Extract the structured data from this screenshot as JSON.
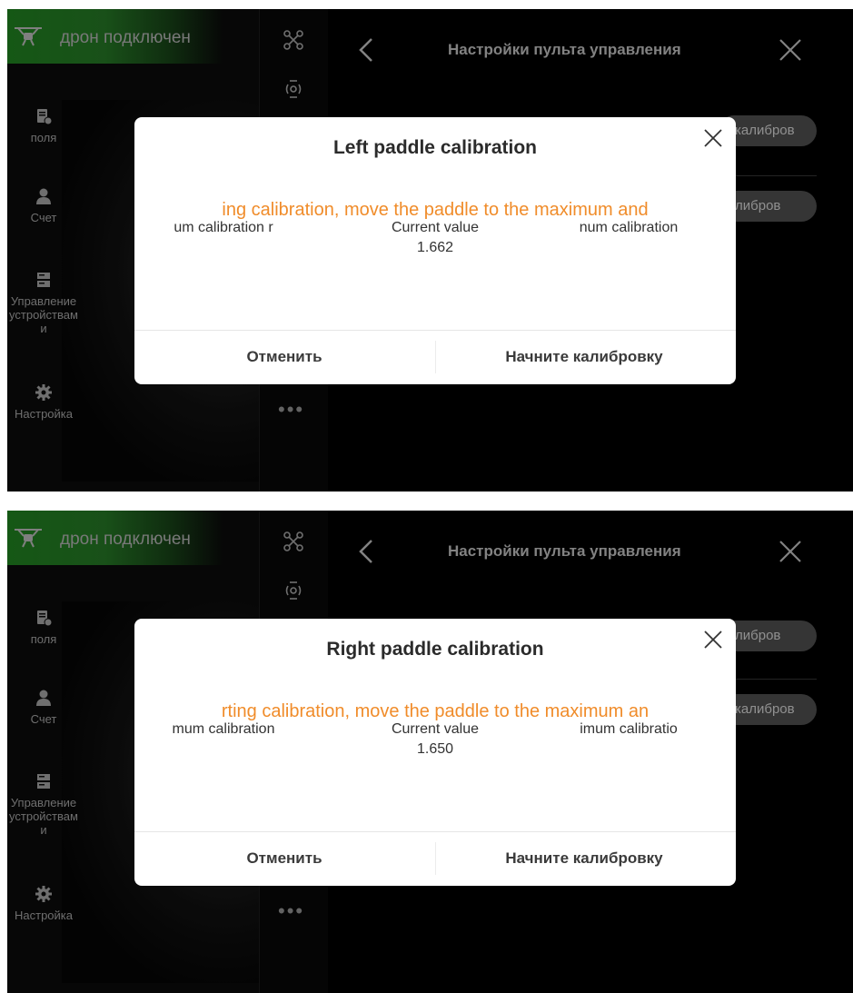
{
  "screens": [
    {
      "status_text": "дрон подключен",
      "nav": [
        {
          "label": "поля",
          "icon": "field-doc-icon"
        },
        {
          "label": "Счет",
          "icon": "user-icon"
        },
        {
          "label": "Управление устройствам и",
          "icon": "server-icon"
        },
        {
          "label": "Настройка",
          "icon": "gear-icon"
        }
      ],
      "panel_title": "Настройки пульта управления",
      "pill_buttons": [
        "калибров",
        "либров"
      ],
      "dialog": {
        "title": "Left paddle calibration",
        "hint": "ing calibration, move the paddle to the maximum and",
        "min_label": "um calibration r",
        "current_label": "Current value",
        "current_value": "1.662",
        "max_label": "num calibration",
        "cancel": "Отменить",
        "start": "Начните калибровку"
      }
    },
    {
      "status_text": "дрон подключен",
      "nav": [
        {
          "label": "поля",
          "icon": "field-doc-icon"
        },
        {
          "label": "Счет",
          "icon": "user-icon"
        },
        {
          "label": "Управление устройствам и",
          "icon": "server-icon"
        },
        {
          "label": "Настройка",
          "icon": "gear-icon"
        }
      ],
      "panel_title": "Настройки пульта управления",
      "pill_buttons": [
        "либров",
        "калибров"
      ],
      "dialog": {
        "title": "Right paddle calibration",
        "hint": "rting calibration, move the paddle to the maximum an",
        "min_label": "mum calibration",
        "current_label": "Current value",
        "current_value": "1.650",
        "max_label": "imum calibratio",
        "cancel": "Отменить",
        "start": "Начните калибровку"
      }
    }
  ],
  "colors": {
    "status_green": "#1e7a1e",
    "hint_orange": "#f08c2a"
  }
}
